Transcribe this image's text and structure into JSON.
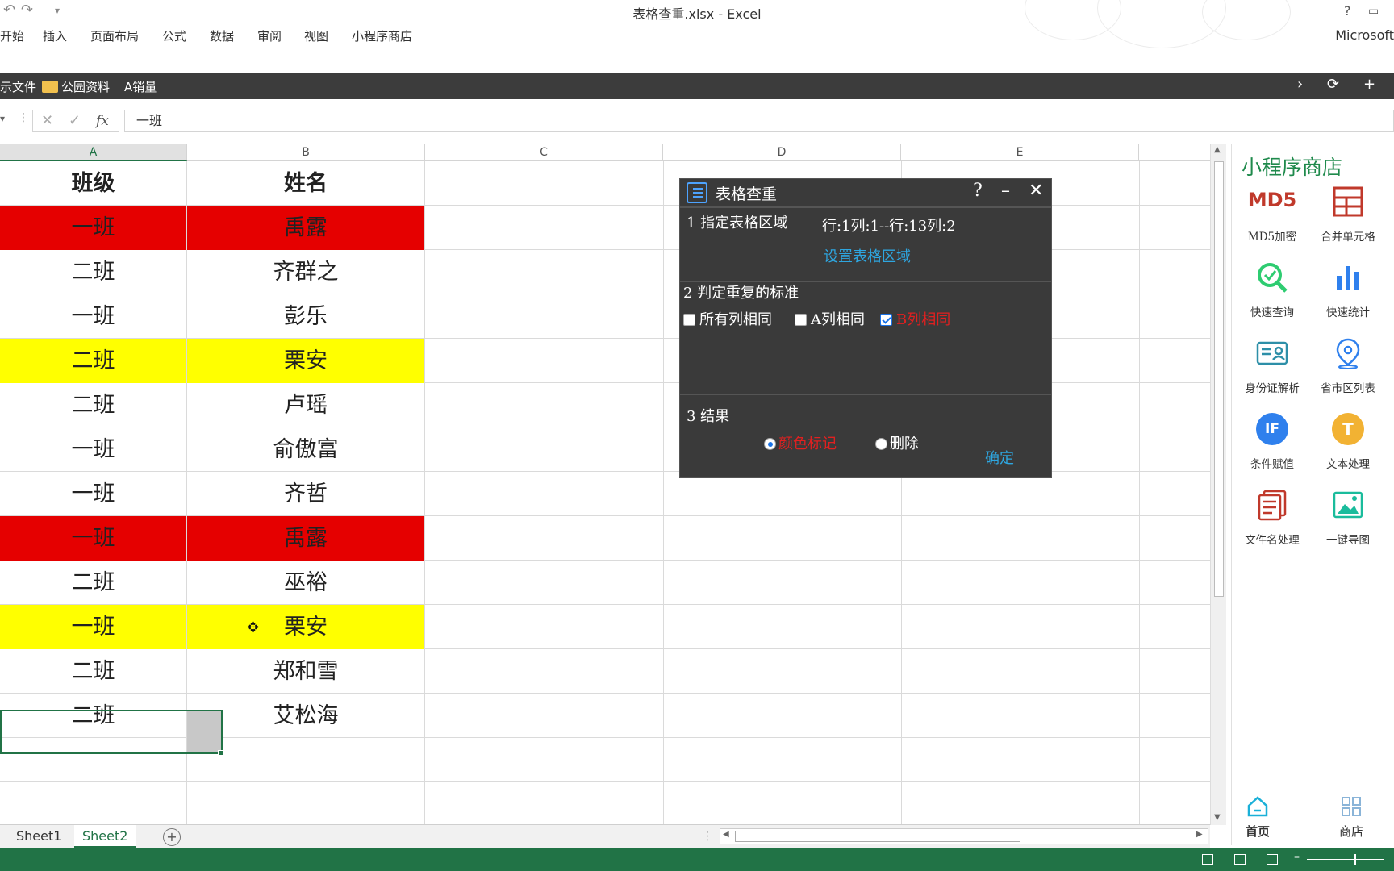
{
  "window": {
    "title": "表格查重.xlsx - Excel",
    "help": "?",
    "account": "Microsoft"
  },
  "ribbon_tabs": [
    "开始",
    "插入",
    "页面布局",
    "公式",
    "数据",
    "审阅",
    "视图",
    "小程序商店"
  ],
  "bookmarks": {
    "item1": "示文件",
    "item2": "公园资料",
    "item3": "A销量"
  },
  "formula_bar": {
    "value": "一班",
    "fx": "fx"
  },
  "columns": [
    "A",
    "B",
    "C",
    "D",
    "E"
  ],
  "sheet": {
    "header": [
      "班级",
      "姓名"
    ],
    "rows": [
      {
        "a": "一班",
        "b": "禹露",
        "highlight": "red"
      },
      {
        "a": "二班",
        "b": "齐群之",
        "highlight": "none"
      },
      {
        "a": "一班",
        "b": "彭乐",
        "highlight": "none"
      },
      {
        "a": "二班",
        "b": "栗安",
        "highlight": "yellow"
      },
      {
        "a": "二班",
        "b": "卢瑶",
        "highlight": "none"
      },
      {
        "a": "一班",
        "b": "俞傲富",
        "highlight": "none"
      },
      {
        "a": "一班",
        "b": "齐哲",
        "highlight": "none"
      },
      {
        "a": "一班",
        "b": "禹露",
        "highlight": "red"
      },
      {
        "a": "二班",
        "b": "巫裕",
        "highlight": "none"
      },
      {
        "a": "一班",
        "b": "栗安",
        "highlight": "yellow"
      },
      {
        "a": "二班",
        "b": "郑和雪",
        "highlight": "none"
      },
      {
        "a": "二班",
        "b": "艾松海",
        "highlight": "none"
      }
    ],
    "colors": {
      "red": "#e50000",
      "yellow": "#ffff00"
    }
  },
  "dialog": {
    "title": "表格查重",
    "help": "?",
    "minimize": "–",
    "close": "✕",
    "step1_label": "1 指定表格区域",
    "range_value": "行:1列:1--行:13列:2",
    "set_range_link": "设置表格区域",
    "step2_label": "2 判定重复的标准",
    "criteria": [
      {
        "label": "所有列相同",
        "checked": false,
        "color": "#ffffff"
      },
      {
        "label": "A列相同",
        "checked": false,
        "color": "#ffffff"
      },
      {
        "label": "B列相同",
        "checked": true,
        "color": "#e02020"
      }
    ],
    "step3_label": "3 结果",
    "results": [
      {
        "label": "颜色标记",
        "selected": true,
        "color": "#e02020"
      },
      {
        "label": "删除",
        "selected": false,
        "color": "#ffffff"
      }
    ],
    "confirm": "确定"
  },
  "side_panel": {
    "title": "小程序商店",
    "tools": [
      {
        "icon": "md5-icon",
        "label": "MD5加密",
        "icon_text": "MD5"
      },
      {
        "icon": "merge-cells-icon",
        "label": "合并单元格"
      },
      {
        "icon": "quick-search-icon",
        "label": "快速查询"
      },
      {
        "icon": "bar-stats-icon",
        "label": "快速统计"
      },
      {
        "icon": "id-card-icon",
        "label": "身份证解析"
      },
      {
        "icon": "location-pin-icon",
        "label": "省市区列表"
      },
      {
        "icon": "if-condition-icon",
        "label": "条件赋值",
        "icon_text": "IF"
      },
      {
        "icon": "text-t-icon",
        "label": "文本处理",
        "icon_text": "T"
      },
      {
        "icon": "file-name-icon",
        "label": "文件名处理"
      },
      {
        "icon": "image-export-icon",
        "label": "一键导图"
      }
    ],
    "nav": [
      {
        "icon": "home-icon",
        "label": "首页"
      },
      {
        "icon": "grid-store-icon",
        "label": "商店"
      }
    ]
  },
  "sheet_tabs": [
    "Sheet1",
    "Sheet2"
  ],
  "active_sheet": "Sheet2"
}
